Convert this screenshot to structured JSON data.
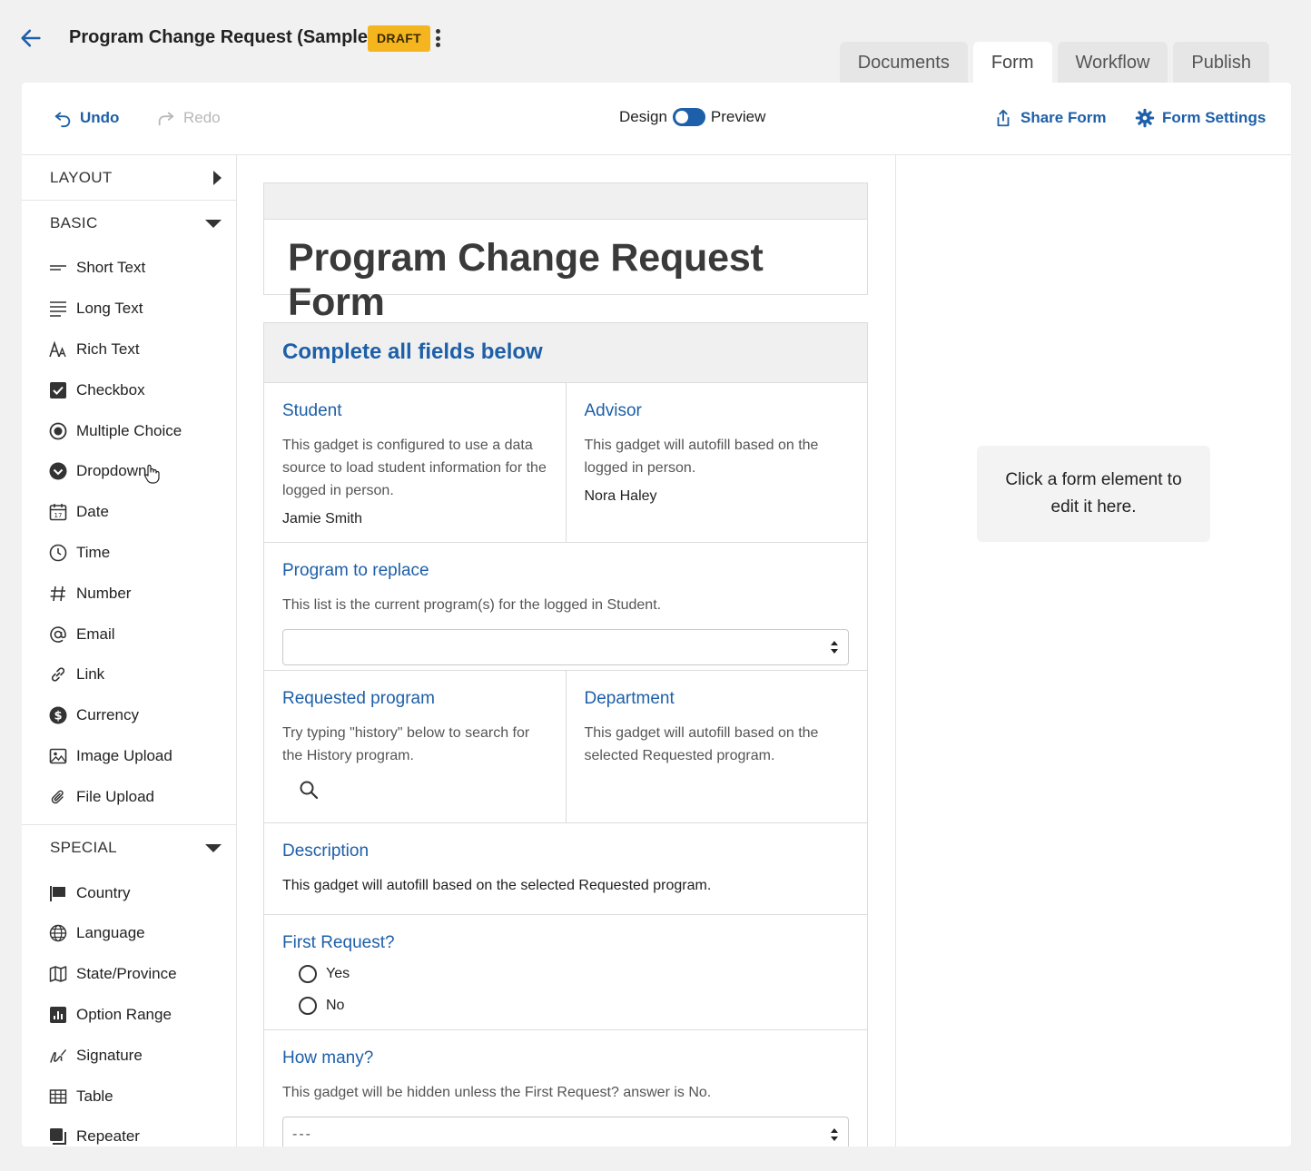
{
  "header": {
    "title": "Program Change Request (Sample)",
    "badge": "DRAFT",
    "tabs": [
      {
        "label": "Documents"
      },
      {
        "label": "Form"
      },
      {
        "label": "Workflow"
      },
      {
        "label": "Publish"
      }
    ],
    "active_tab": "Form"
  },
  "toolbar": {
    "undo": "Undo",
    "redo": "Redo",
    "design": "Design",
    "preview": "Preview",
    "share": "Share Form",
    "settings": "Form Settings"
  },
  "sidebar": {
    "layout": "LAYOUT",
    "basic": "BASIC",
    "special": "SPECIAL",
    "basic_items": [
      {
        "label": "Short Text",
        "icon": "short-text-icon"
      },
      {
        "label": "Long Text",
        "icon": "long-text-icon"
      },
      {
        "label": "Rich Text",
        "icon": "rich-text-icon"
      },
      {
        "label": "Checkbox",
        "icon": "checkbox-icon"
      },
      {
        "label": "Multiple Choice",
        "icon": "radio-icon"
      },
      {
        "label": "Dropdown",
        "icon": "dropdown-icon"
      },
      {
        "label": "Date",
        "icon": "calendar-icon"
      },
      {
        "label": "Time",
        "icon": "clock-icon"
      },
      {
        "label": "Number",
        "icon": "hash-icon"
      },
      {
        "label": "Email",
        "icon": "at-icon"
      },
      {
        "label": "Link",
        "icon": "link-icon"
      },
      {
        "label": "Currency",
        "icon": "dollar-icon"
      },
      {
        "label": "Image Upload",
        "icon": "image-icon"
      },
      {
        "label": "File Upload",
        "icon": "paperclip-icon"
      }
    ],
    "special_items": [
      {
        "label": "Country",
        "icon": "flag-icon"
      },
      {
        "label": "Language",
        "icon": "globe-icon"
      },
      {
        "label": "State/Province",
        "icon": "map-icon"
      },
      {
        "label": "Option Range",
        "icon": "bar-chart-icon"
      },
      {
        "label": "Signature",
        "icon": "signature-icon"
      },
      {
        "label": "Table",
        "icon": "table-icon"
      },
      {
        "label": "Repeater",
        "icon": "repeater-icon"
      }
    ]
  },
  "form": {
    "title": "Program Change Request Form",
    "section_title": "Complete all fields below",
    "student": {
      "label": "Student",
      "hint": "This gadget is configured to use a data source to load student information for the logged in person.",
      "value": "Jamie Smith"
    },
    "advisor": {
      "label": "Advisor",
      "hint": "This gadget will autofill based on the logged in person.",
      "value": "Nora Haley"
    },
    "program_replace": {
      "label": "Program to replace",
      "hint": "This list is the current program(s) for the logged in Student.",
      "value": ""
    },
    "requested_program": {
      "label": "Requested program",
      "hint": "Try typing \"history\" below to search for the History program."
    },
    "department": {
      "label": "Department",
      "hint": "This gadget will autofill based on the selected Requested program."
    },
    "description": {
      "label": "Description",
      "hint": "This gadget will autofill based on the selected Requested program."
    },
    "first_request": {
      "label": "First Request?",
      "options": [
        "Yes",
        "No"
      ]
    },
    "how_many": {
      "label": "How many?",
      "hint": "This gadget will be hidden unless the First Request? answer is No.",
      "value": "---"
    }
  },
  "right_panel": {
    "hint": "Click a form element to edit it here."
  },
  "colors": {
    "accent": "#1d5fa8",
    "badge": "#f4b51f"
  }
}
